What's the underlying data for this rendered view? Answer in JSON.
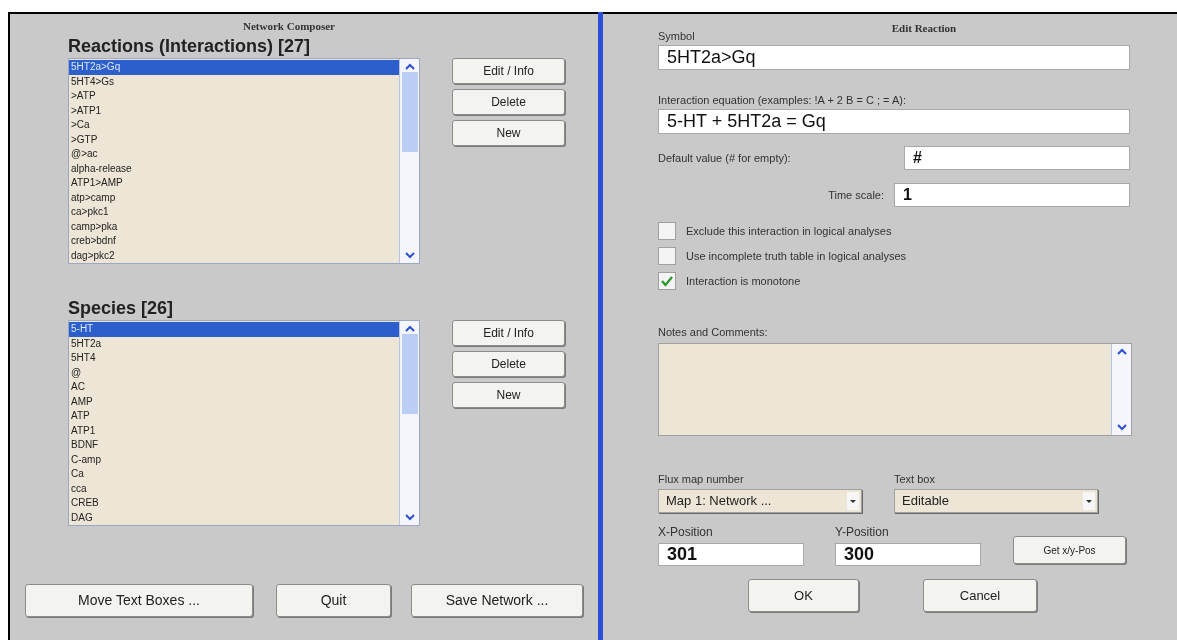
{
  "composer": {
    "title": "Network Composer",
    "reactions": {
      "heading": "Reactions (Interactions) [27]",
      "items": [
        {
          "label": "5HT2a>Gq",
          "selected": true
        },
        {
          "label": "5HT4>Gs",
          "selected": false
        },
        {
          "label": ">ATP",
          "selected": false
        },
        {
          "label": ">ATP1",
          "selected": false
        },
        {
          "label": ">Ca",
          "selected": false
        },
        {
          "label": ">GTP",
          "selected": false
        },
        {
          "label": "@>ac",
          "selected": false
        },
        {
          "label": "alpha-release",
          "selected": false
        },
        {
          "label": "ATP1>AMP",
          "selected": false
        },
        {
          "label": "atp>camp",
          "selected": false
        },
        {
          "label": "ca>pkc1",
          "selected": false
        },
        {
          "label": "camp>pka",
          "selected": false
        },
        {
          "label": "creb>bdnf",
          "selected": false
        },
        {
          "label": "dag>pkc2",
          "selected": false
        }
      ],
      "buttons": [
        "Edit / Info",
        "Delete",
        "New"
      ]
    },
    "species": {
      "heading": "Species [26]",
      "items": [
        {
          "label": "5-HT",
          "selected": true
        },
        {
          "label": "5HT2a",
          "selected": false
        },
        {
          "label": "5HT4",
          "selected": false
        },
        {
          "label": "@",
          "selected": false
        },
        {
          "label": "AC",
          "selected": false
        },
        {
          "label": "AMP",
          "selected": false
        },
        {
          "label": "ATP",
          "selected": false
        },
        {
          "label": "ATP1",
          "selected": false
        },
        {
          "label": "BDNF",
          "selected": false
        },
        {
          "label": "C-amp",
          "selected": false
        },
        {
          "label": "Ca",
          "selected": false
        },
        {
          "label": "cca",
          "selected": false
        },
        {
          "label": "CREB",
          "selected": false
        },
        {
          "label": "DAG",
          "selected": false
        }
      ],
      "buttons": [
        "Edit / Info",
        "Delete",
        "New"
      ]
    },
    "bottom_buttons": [
      "Move Text Boxes ...",
      "Quit",
      "Save Network ..."
    ]
  },
  "edit_reaction": {
    "title": "Edit Reaction",
    "symbol": {
      "label": "Symbol",
      "value": "5HT2a>Gq"
    },
    "equation": {
      "label": "Interaction equation (examples: !A + 2 B = C ;  = A):",
      "value": "5-HT + 5HT2a = Gq"
    },
    "default_value": {
      "label": "Default value (# for empty):",
      "value": "#"
    },
    "time_scale": {
      "label": "Time scale:",
      "value": "1"
    },
    "options": [
      {
        "label": "Exclude this interaction in logical analyses",
        "checked": false
      },
      {
        "label": "Use incomplete truth table in logical analyses",
        "checked": false
      },
      {
        "label": "Interaction is monotone",
        "checked": true
      }
    ],
    "notes": {
      "label": "Notes and Comments:"
    },
    "flux_map": {
      "label": "Flux map number",
      "value": "Map 1: Network ..."
    },
    "text_box": {
      "label": "Text box",
      "value": "Editable"
    },
    "x_position": {
      "label": "X-Position",
      "value": "301"
    },
    "y_position": {
      "label": "Y-Position",
      "value": "300"
    },
    "get_pos_button": "Get x/y-Pos",
    "buttons": [
      "OK",
      "Cancel"
    ]
  }
}
